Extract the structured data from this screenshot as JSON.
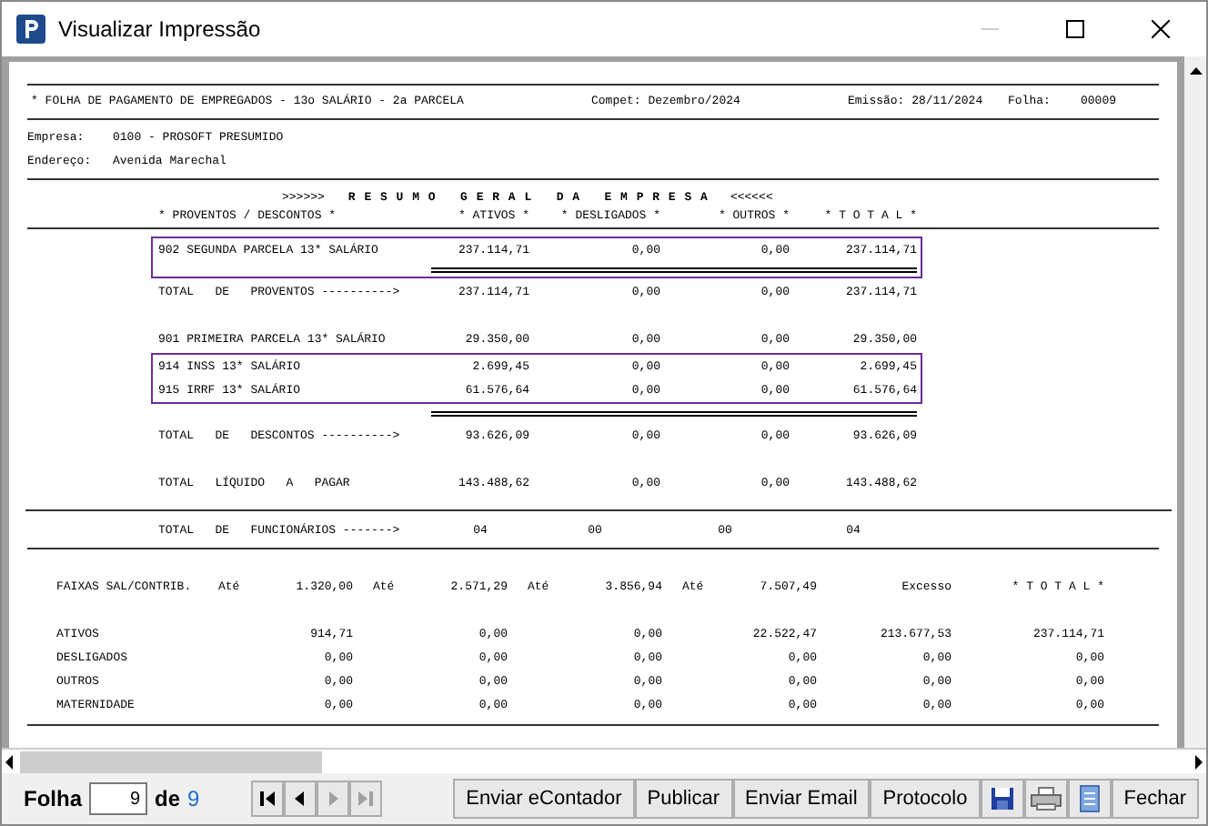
{
  "window": {
    "title": "Visualizar Impressão"
  },
  "report": {
    "title": "* FOLHA DE PAGAMENTO DE EMPREGADOS - 13o SALÁRIO - 2a PARCELA",
    "compet": "Compet: Dezembro/2024",
    "emissao": "Emissão: 28/11/2024",
    "folha_label": "Folha:",
    "folha_value": "00009",
    "fields": [
      {
        "label": "Empresa:",
        "value": "0100 - PROSOFT PRESUMIDO"
      },
      {
        "label": "Endereço:",
        "value": "Avenida Marechal"
      }
    ],
    "summary_title": {
      "left": ">>>>>>",
      "text": "R E S U M O   G E R A L   D A   E M P R E S A",
      "right": "<<<<<<"
    },
    "summary_columns": [
      "* PROVENTOS / DESCONTOS *",
      "* ATIVOS *",
      "* DESLIGADOS *",
      "* OUTROS *",
      "* T O T A L *"
    ],
    "summary_rows": [
      {
        "kind": "item",
        "highlighted": true,
        "cells": [
          "902 SEGUNDA PARCELA 13* SALÁRIO",
          "237.114,71",
          "0,00",
          "0,00",
          "237.114,71"
        ]
      },
      {
        "kind": "separator",
        "highlighted": true
      },
      {
        "kind": "total",
        "highlighted": false,
        "cells": [
          "TOTAL   DE   PROVENTOS ---------->",
          "237.114,71",
          "0,00",
          "0,00",
          "237.114,71"
        ]
      },
      {
        "kind": "item",
        "highlighted": false,
        "cells": [
          "901 PRIMEIRA PARCELA 13* SALÁRIO",
          "29.350,00",
          "0,00",
          "0,00",
          "29.350,00"
        ]
      },
      {
        "kind": "item",
        "highlighted": true,
        "cells": [
          "914 INSS 13* SALÁRIO",
          "2.699,45",
          "0,00",
          "0,00",
          "2.699,45"
        ]
      },
      {
        "kind": "item",
        "highlighted": true,
        "cells": [
          "915 IRRF 13* SALÁRIO",
          "61.576,64",
          "0,00",
          "0,00",
          "61.576,64"
        ]
      },
      {
        "kind": "separator",
        "highlighted": false
      },
      {
        "kind": "total",
        "highlighted": false,
        "cells": [
          "TOTAL   DE   DESCONTOS ---------->",
          "93.626,09",
          "0,00",
          "0,00",
          "93.626,09"
        ]
      },
      {
        "kind": "total",
        "highlighted": false,
        "cells": [
          "TOTAL   LÍQUIDO   A   PAGAR",
          "143.488,62",
          "0,00",
          "0,00",
          "143.488,62"
        ]
      },
      {
        "kind": "count",
        "highlighted": false,
        "cells": [
          "TOTAL   DE   FUNCIONÁRIOS ------->",
          "04",
          "00",
          "00",
          "04"
        ]
      }
    ],
    "bands": {
      "label": "FAIXAS SAL/CONTRIB.",
      "columns": [
        {
          "prefix": "Até",
          "value": "1.320,00"
        },
        {
          "prefix": "Até",
          "value": "2.571,29"
        },
        {
          "prefix": "Até",
          "value": "3.856,94"
        },
        {
          "prefix": "Até",
          "value": "7.507,49"
        },
        {
          "value": "Excesso"
        },
        {
          "value": "* T O T A L *"
        }
      ],
      "rows": [
        {
          "label": "ATIVOS",
          "values": [
            "914,71",
            "0,00",
            "0,00",
            "22.522,47",
            "213.677,53",
            "237.114,71"
          ]
        },
        {
          "label": "DESLIGADOS",
          "values": [
            "0,00",
            "0,00",
            "0,00",
            "0,00",
            "0,00",
            "0,00"
          ]
        },
        {
          "label": "OUTROS",
          "values": [
            "0,00",
            "0,00",
            "0,00",
            "0,00",
            "0,00",
            "0,00"
          ]
        },
        {
          "label": "MATERNIDADE",
          "values": [
            "0,00",
            "0,00",
            "0,00",
            "0,00",
            "0,00",
            "0,00"
          ]
        }
      ]
    }
  },
  "toolbar": {
    "page_label": "Folha",
    "page_value": "9",
    "of_label": "de",
    "page_count": "9",
    "nav": [
      {
        "kind": "first",
        "disabled": false
      },
      {
        "kind": "prev",
        "disabled": false
      },
      {
        "kind": "next",
        "disabled": true
      },
      {
        "kind": "last",
        "disabled": true
      }
    ],
    "buttons": [
      {
        "kind": "text",
        "label": "Enviar eContador"
      },
      {
        "kind": "text",
        "label": "Publicar"
      },
      {
        "kind": "text",
        "label": "Enviar Email"
      },
      {
        "kind": "text",
        "label": "Protocolo"
      },
      {
        "kind": "save"
      },
      {
        "kind": "print"
      },
      {
        "kind": "document"
      },
      {
        "kind": "text",
        "label": "Fechar"
      }
    ]
  }
}
